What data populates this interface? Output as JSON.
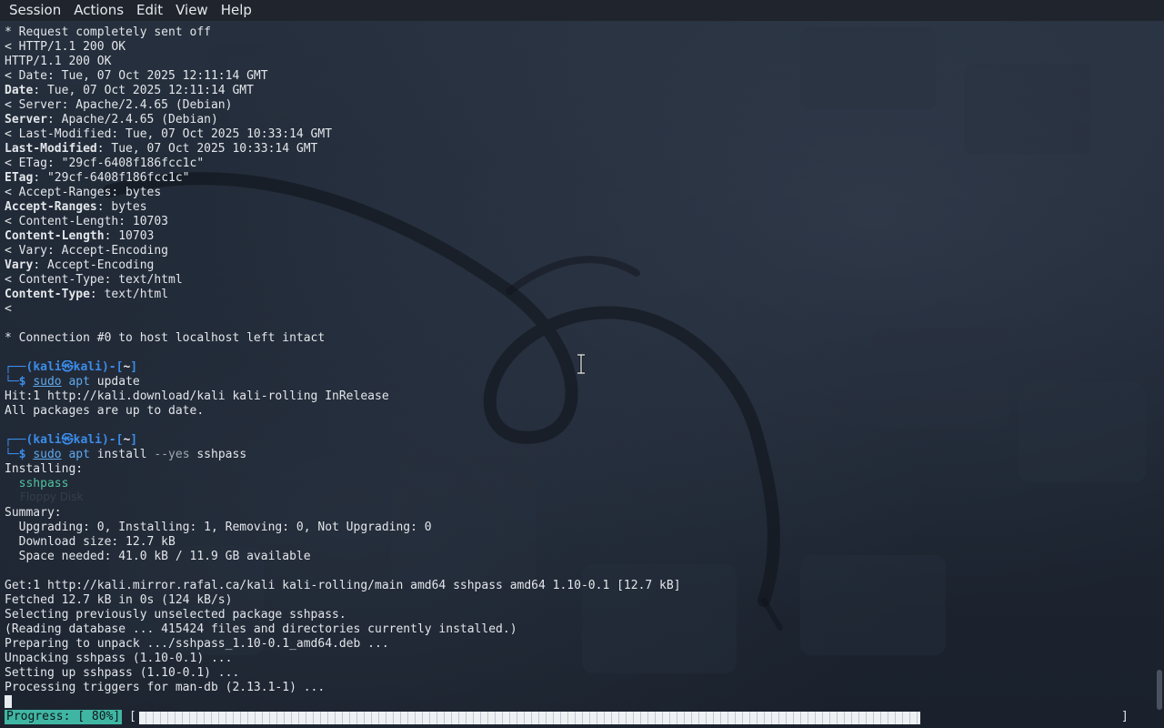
{
  "menubar": {
    "items": [
      "Session",
      "Actions",
      "Edit",
      "View",
      "Help"
    ]
  },
  "terminal": {
    "lines": [
      "* Request completely sent off",
      "< HTTP/1.1 200 OK",
      "HTTP/1.1 200 OK",
      "< Date: Tue, 07 Oct 2025 12:11:14 GMT",
      "Date: Tue, 07 Oct 2025 12:11:14 GMT",
      "< Server: Apache/2.4.65 (Debian)",
      "Server: Apache/2.4.65 (Debian)",
      "< Last-Modified: Tue, 07 Oct 2025 10:33:14 GMT",
      "Last-Modified: Tue, 07 Oct 2025 10:33:14 GMT",
      "< ETag: \"29cf-6408f186fcc1c\"",
      "ETag: \"29cf-6408f186fcc1c\"",
      "< Accept-Ranges: bytes",
      "Accept-Ranges: bytes",
      "< Content-Length: 10703",
      "Content-Length: 10703",
      "< Vary: Accept-Encoding",
      "Vary: Accept-Encoding",
      "< Content-Type: text/html",
      "Content-Type: text/html",
      "<",
      "",
      "* Connection #0 to host localhost left intact",
      "",
      "__PROMPT1__",
      "__CMD1__",
      "Hit:1 http://kali.download/kali kali-rolling InRelease",
      "All packages are up to date.",
      "",
      "__PROMPT2__",
      "__CMD2__",
      "Installing:",
      "__PKG__",
      "",
      "Summary:",
      "  Upgrading: 0, Installing: 1, Removing: 0, Not Upgrading: 0",
      "  Download size: 12.7 kB",
      "  Space needed: 41.0 kB / 11.9 GB available",
      "",
      "Get:1 http://kali.mirror.rafal.ca/kali kali-rolling/main amd64 sshpass amd64 1.10-0.1 [12.7 kB]",
      "Fetched 12.7 kB in 0s (124 kB/s)",
      "Selecting previously unselected package sshpass.",
      "(Reading database ... 415424 files and directories currently installed.)",
      "Preparing to unpack .../sshpass_1.10-0.1_amd64.deb ...",
      "Unpacking sshpass (1.10-0.1) ...",
      "Setting up sshpass (1.10-0.1) ...",
      "Processing triggers for man-db (2.13.1-1) ..."
    ],
    "prompt": {
      "top_left": "┌──(",
      "user": "kali",
      "at": "㉿",
      "host": "kali",
      "mid": ")-[",
      "dir": "~",
      "end": "]",
      "bottom_left": "└─",
      "dollar": "$"
    },
    "commands": [
      {
        "sudo": "sudo",
        "apt": "apt",
        "args": "update",
        "opt": ""
      },
      {
        "sudo": "sudo",
        "apt": "apt",
        "args": "install",
        "opt": "--yes",
        "pkg": "sshpass"
      }
    ],
    "package": "sshpass"
  },
  "progress": {
    "label": "Progress: [ 80%]",
    "percent": 80,
    "open_bracket": "[",
    "close_bracket": "]"
  },
  "ghost_text": "Floppy Disk",
  "colors": {
    "prompt_blue": "#3b8ce8",
    "progress_teal": "#3fb6a3",
    "background": "#1c2330"
  }
}
